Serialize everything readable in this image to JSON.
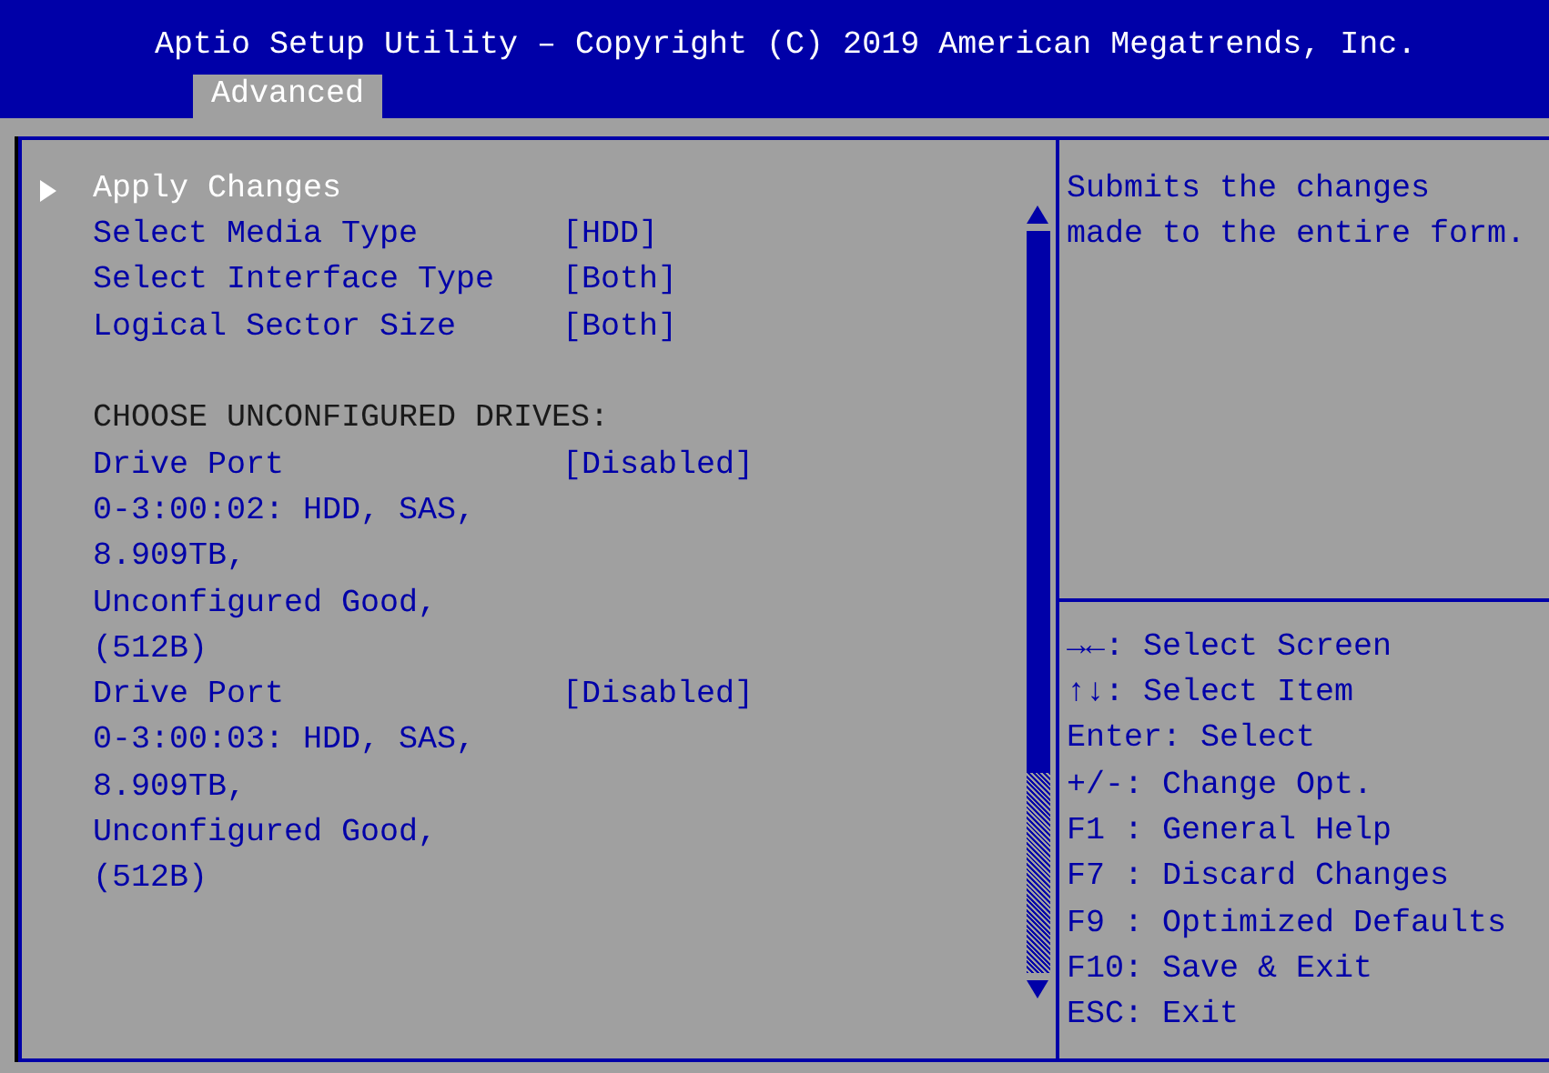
{
  "header": {
    "title": "Aptio Setup Utility – Copyright (C) 2019 American Megatrends, Inc.",
    "tabs": [
      {
        "label": "Advanced",
        "selected": true
      }
    ]
  },
  "items": [
    {
      "kind": "action",
      "label": "Apply Changes",
      "selected": true
    },
    {
      "kind": "setting",
      "label": "Select Media Type",
      "value": "[HDD]",
      "selected": false
    },
    {
      "kind": "setting",
      "label": "Select Interface Type",
      "value": "[Both]",
      "selected": false
    },
    {
      "kind": "setting",
      "label": "Logical Sector Size",
      "value": "[Both]",
      "selected": false
    },
    {
      "kind": "heading",
      "label": "CHOOSE UNCONFIGURED DRIVES:"
    },
    {
      "kind": "setting",
      "label": "Drive Port",
      "value": "[Disabled]",
      "selected": false
    },
    {
      "kind": "info",
      "label": "0-3:00:02: HDD, SAS,"
    },
    {
      "kind": "info",
      "label": "8.909TB,"
    },
    {
      "kind": "info",
      "label": "Unconfigured Good,"
    },
    {
      "kind": "info",
      "label": "(512B)"
    },
    {
      "kind": "setting",
      "label": "Drive Port",
      "value": "[Disabled]",
      "selected": false
    },
    {
      "kind": "info",
      "label": "0-3:00:03: HDD, SAS,"
    },
    {
      "kind": "info",
      "label": "8.909TB,"
    },
    {
      "kind": "info",
      "label": "Unconfigured Good,"
    },
    {
      "kind": "info",
      "label": "(512B)"
    }
  ],
  "help": [
    "Submits the changes",
    "made to the entire form."
  ],
  "keys": [
    {
      "key": "→←",
      "action": ": Select Screen"
    },
    {
      "key": "↑↓",
      "action": ": Select Item"
    },
    {
      "key": "Enter",
      "action": ": Select"
    },
    {
      "key": "+/-",
      "action": ": Change Opt."
    },
    {
      "key": "F1 ",
      "action": ": General Help"
    },
    {
      "key": "F7 ",
      "action": ": Discard Changes"
    },
    {
      "key": "F9 ",
      "action": ": Optimized Defaults"
    },
    {
      "key": "F10",
      "action": ": Save & Exit"
    },
    {
      "key": "ESC",
      "action": ": Exit"
    }
  ]
}
